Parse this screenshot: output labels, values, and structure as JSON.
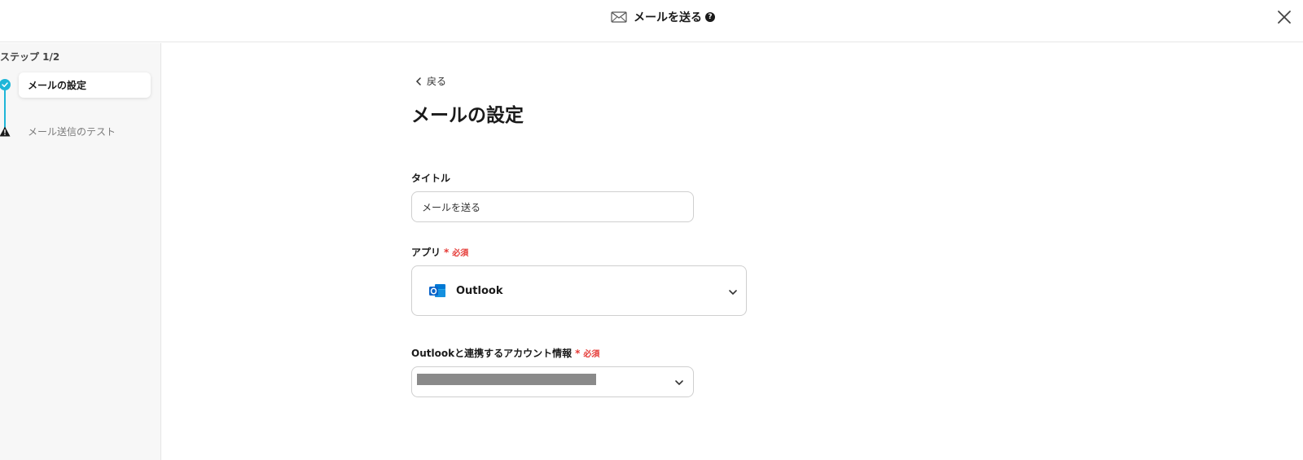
{
  "header": {
    "title": "メールを送る",
    "help": "?"
  },
  "sidebar": {
    "step_count": "ステップ 1/2",
    "steps": [
      {
        "label": "メールの設定",
        "status": "done"
      },
      {
        "label": "メール送信のテスト",
        "status": "warning"
      }
    ]
  },
  "main": {
    "back_label": "戻る",
    "page_title": "メールの設定",
    "title_field": {
      "label": "タイトル",
      "value": "メールを送る"
    },
    "app_field": {
      "label": "アプリ",
      "required_mark": "*",
      "required_label": "必須",
      "value": "Outlook"
    },
    "account_field": {
      "label": "Outlookと連携するアカウント情報",
      "required_mark": "*",
      "required_label": "必須"
    }
  },
  "colors": {
    "accent": "#1fb6d8",
    "required": "#e53935",
    "outlook_blue": "#0a64c9"
  }
}
